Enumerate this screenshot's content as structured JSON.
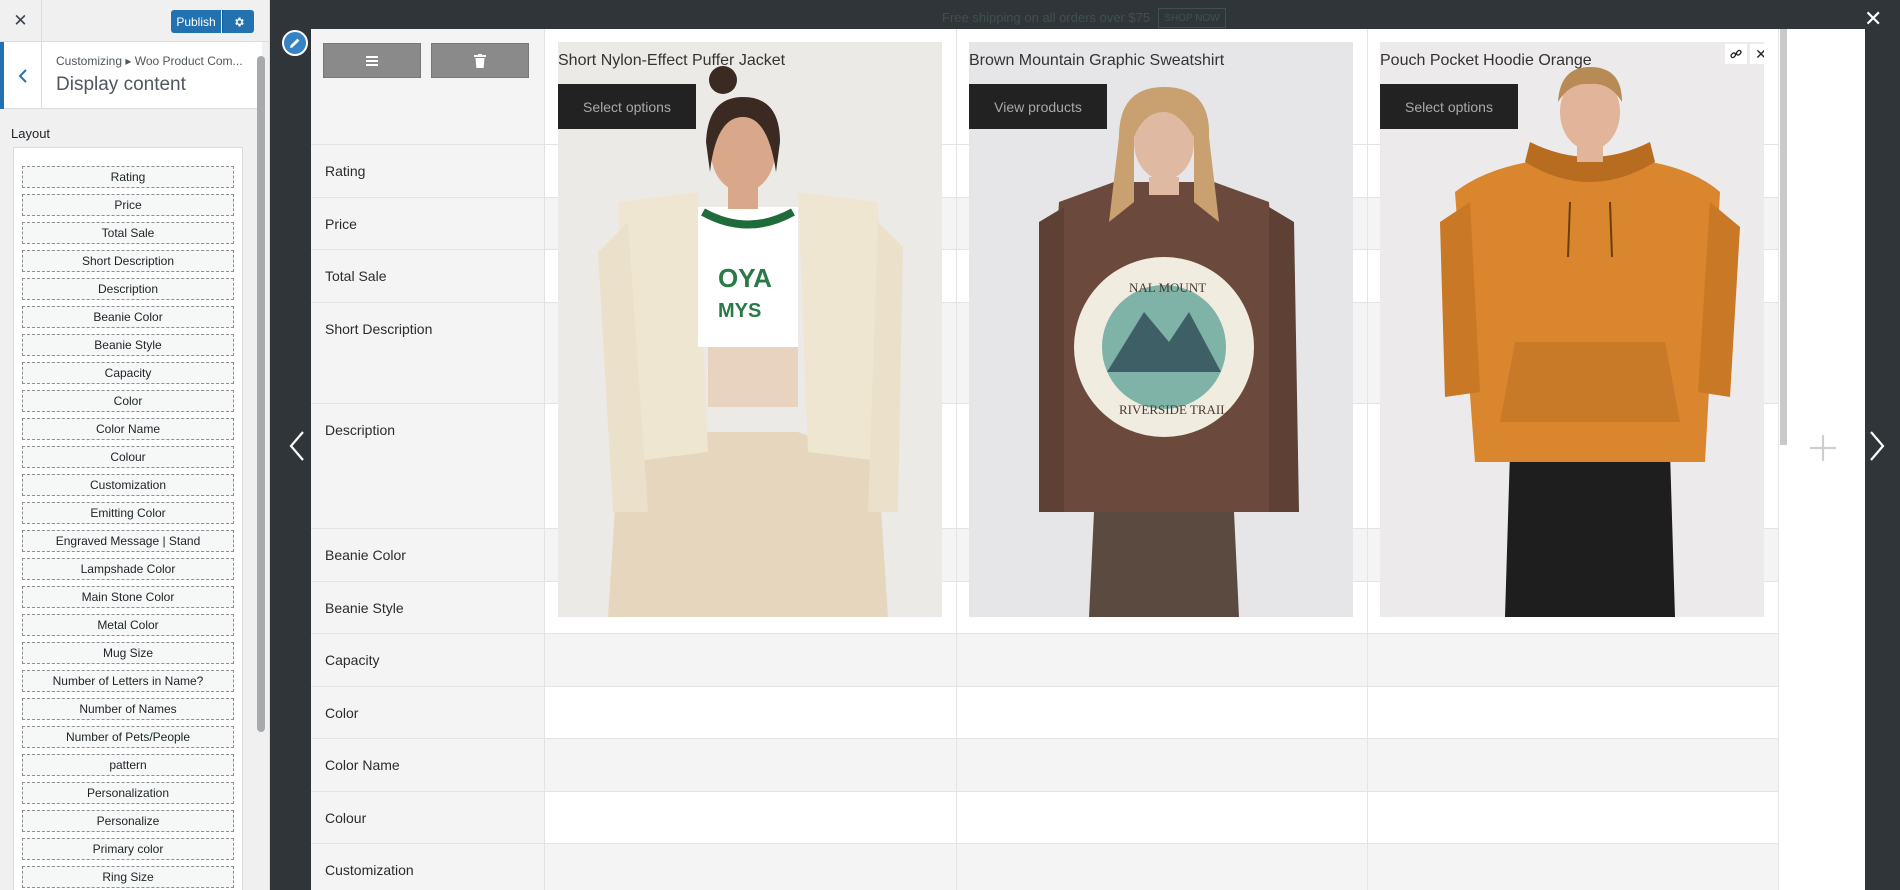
{
  "customizer": {
    "close_icon": "close-icon",
    "publish_label": "Publish",
    "settings_icon": "gear-icon",
    "breadcrumb": "Customizing ▸ Woo Product Com...",
    "section_title": "Display content",
    "layout_label": "Layout",
    "layout_items": [
      "Rating",
      "Price",
      "Total Sale",
      "Short Description",
      "Description",
      "Beanie Color",
      "Beanie Style",
      "Capacity",
      "Color",
      "Color Name",
      "Colour",
      "Customization",
      "Emitting Color",
      "Engraved Message | Stand",
      "Lampshade Color",
      "Main Stone Color",
      "Metal Color",
      "Mug Size",
      "Number of Letters in Name?",
      "Number of Names",
      "Number of Pets/People",
      "pattern",
      "Personalization",
      "Personalize",
      "Primary color",
      "Ring Size"
    ]
  },
  "preview": {
    "topbar_text": "Free shipping on all orders over $75",
    "topbar_button": "SHOP NOW",
    "close_icon": "close-icon",
    "add_icon": "plus-icon"
  },
  "compare": {
    "row_labels": [
      "Rating",
      "Price",
      "Total Sale",
      "Short Description",
      "Description",
      "Beanie Color",
      "Beanie Style",
      "Capacity",
      "Color",
      "Color Name",
      "Colour",
      "Customization"
    ],
    "products": [
      {
        "name": "Short Nylon-Effect Puffer Jacket",
        "button": "Select options"
      },
      {
        "name": "Brown Mountain Graphic Sweatshirt",
        "button": "View products"
      },
      {
        "name": "Pouch Pocket Hoodie Orange",
        "button": "Select options"
      }
    ]
  },
  "colors": {
    "accent": "#2271b1",
    "overlay": "#2f3538",
    "product_button": "#222222"
  }
}
